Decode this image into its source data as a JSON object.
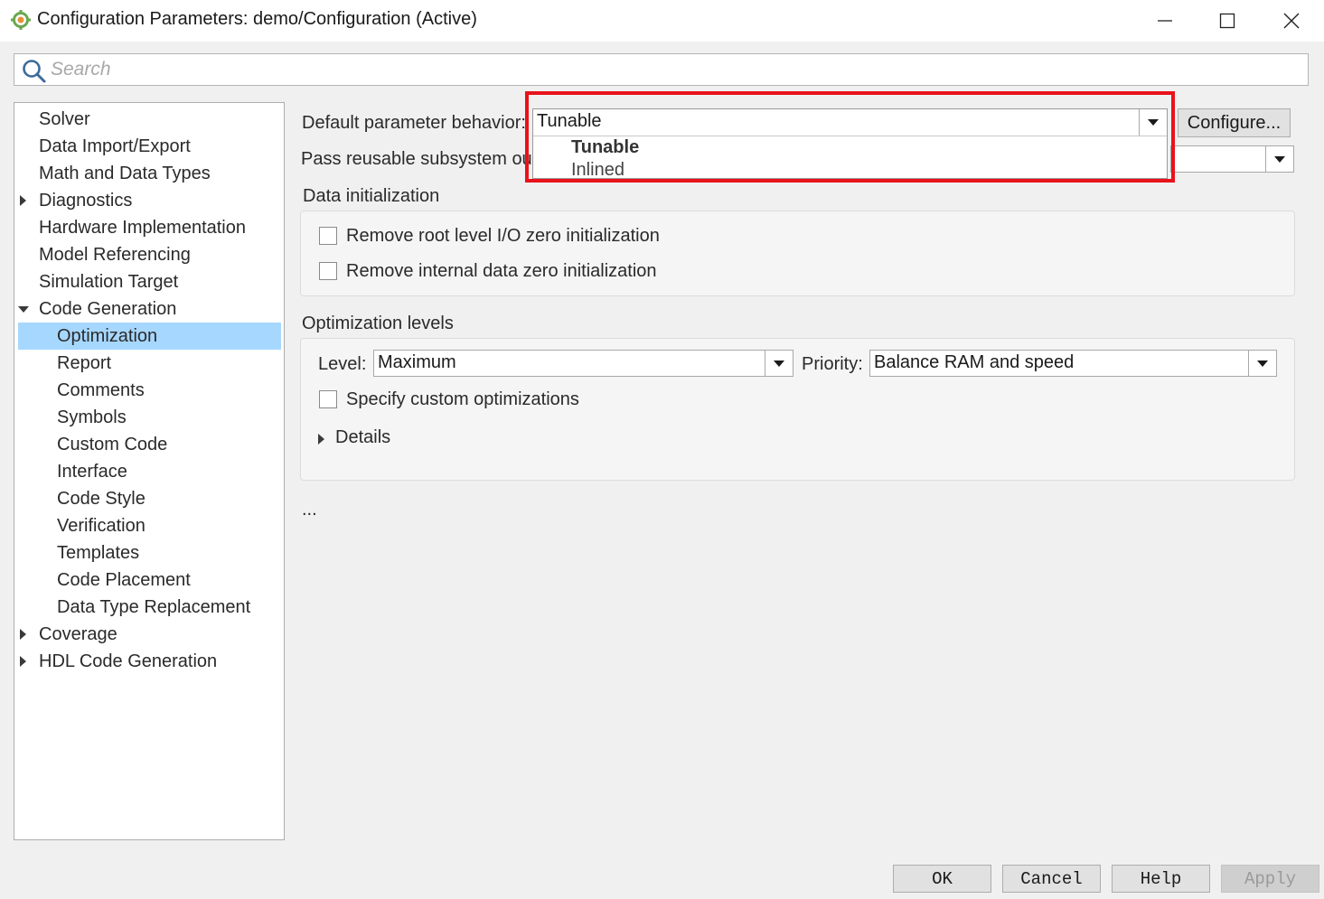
{
  "window": {
    "title": "Configuration Parameters: demo/Configuration (Active)",
    "icon": "gear-icon",
    "controls": [
      "minimize-icon",
      "maximize-icon",
      "close-icon"
    ]
  },
  "search": {
    "placeholder": "Search",
    "value": ""
  },
  "tree": {
    "items": [
      {
        "label": "Solver"
      },
      {
        "label": "Data Import/Export"
      },
      {
        "label": "Math and Data Types"
      },
      {
        "label": "Diagnostics",
        "expander": "collapsed"
      },
      {
        "label": "Hardware Implementation"
      },
      {
        "label": "Model Referencing"
      },
      {
        "label": "Simulation Target"
      },
      {
        "label": "Code Generation",
        "expander": "expanded"
      },
      {
        "label": "Optimization",
        "selected": true
      },
      {
        "label": "Report"
      },
      {
        "label": "Comments"
      },
      {
        "label": "Symbols"
      },
      {
        "label": "Custom Code"
      },
      {
        "label": "Interface"
      },
      {
        "label": "Code Style"
      },
      {
        "label": "Verification"
      },
      {
        "label": "Templates"
      },
      {
        "label": "Code Placement"
      },
      {
        "label": "Data Type Replacement"
      },
      {
        "label": "Coverage",
        "expander": "collapsed"
      },
      {
        "label": "HDL Code Generation",
        "expander": "collapsed"
      }
    ]
  },
  "main": {
    "default_param_label": "Default parameter behavior:",
    "default_param_value": "Tunable",
    "configure_label": "Configure...",
    "dropdown_options": [
      "Tunable",
      "Inlined"
    ],
    "pass_reusable_label": "Pass reusable subsystem ou",
    "data_init": {
      "title": "Data initialization",
      "remove_root_label": "Remove root level I/O zero initialization",
      "remove_root_checked": false,
      "remove_internal_label": "Remove internal data zero initialization",
      "remove_internal_checked": false
    },
    "opt_levels": {
      "title": "Optimization levels",
      "level_label": "Level:",
      "level_value": "Maximum",
      "priority_label": "Priority:",
      "priority_value": "Balance RAM and speed",
      "custom_label": "Specify custom optimizations",
      "custom_checked": false,
      "details_label": "Details"
    },
    "ellipsis": "..."
  },
  "footer": {
    "ok": "OK",
    "cancel": "Cancel",
    "help": "Help",
    "apply": "Apply"
  },
  "colors": {
    "selection": "#a6d7ff",
    "highlight_border": "#e8121b"
  }
}
